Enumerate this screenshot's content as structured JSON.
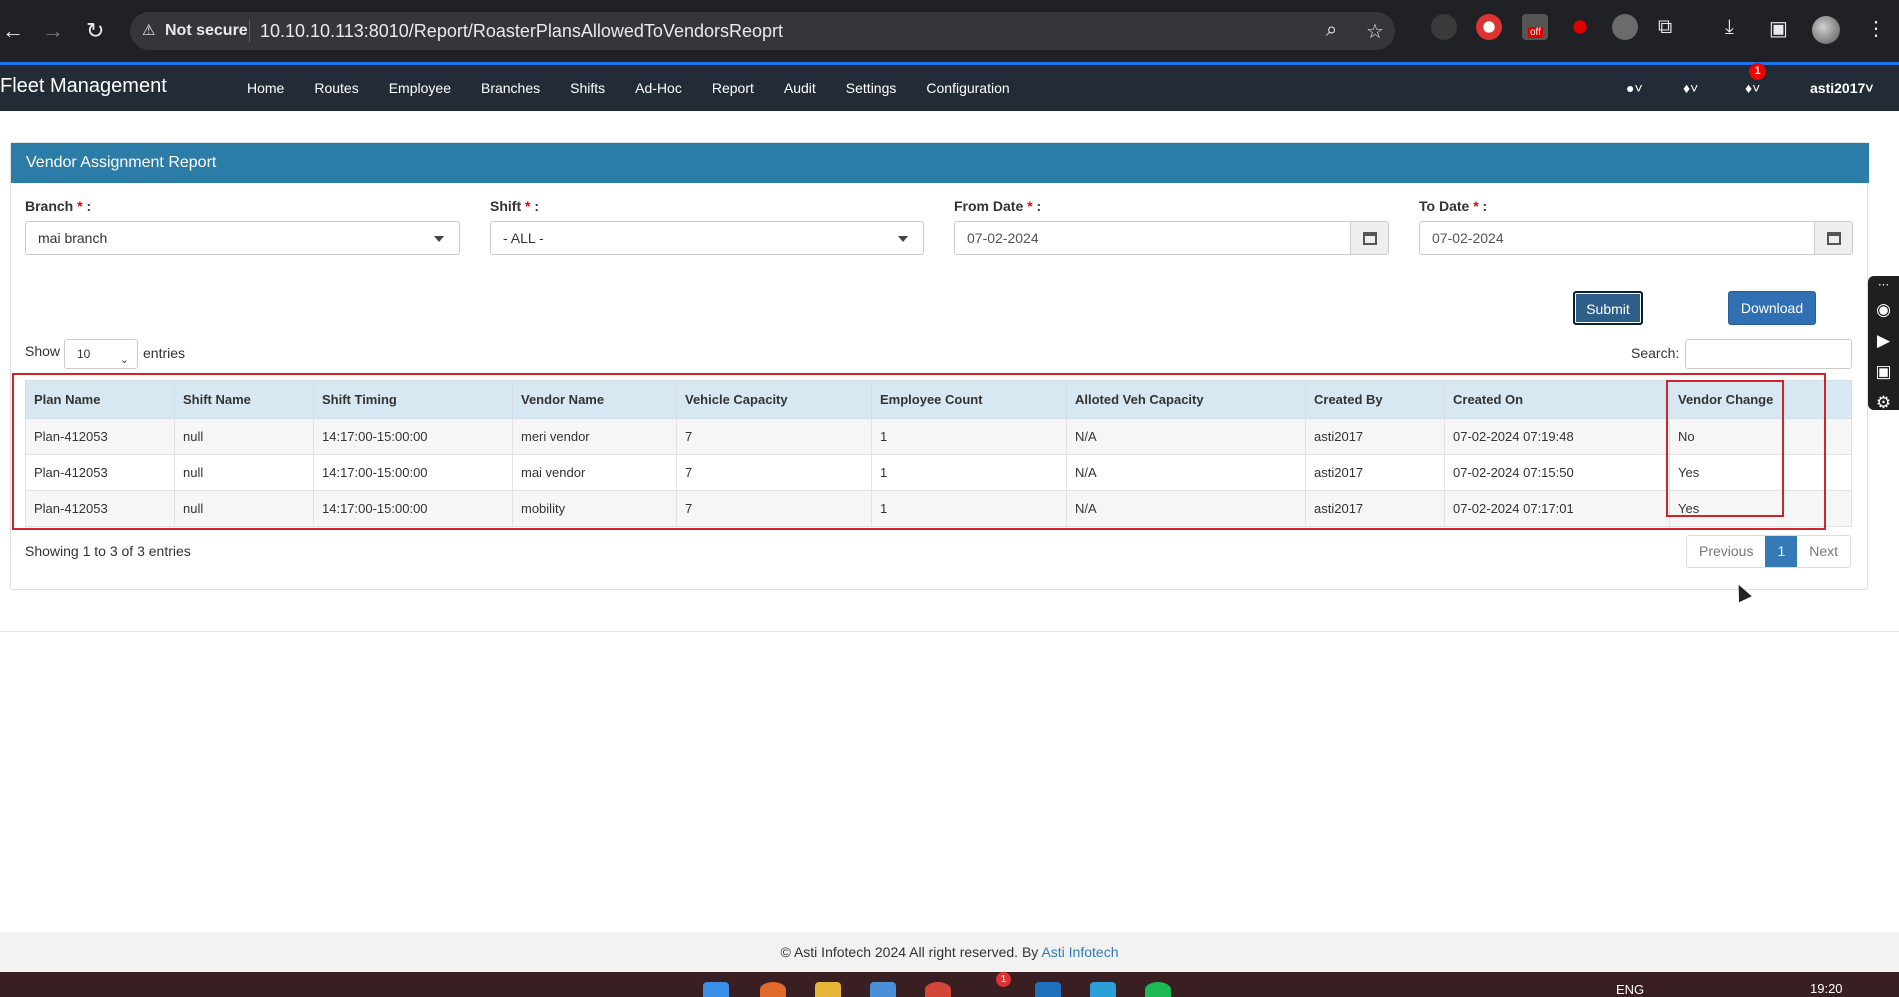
{
  "browser": {
    "not_secure": "Not secure",
    "url": "10.10.10.113:8010/Report/RoasterPlansAllowedToVendorsReoprt",
    "ext_badge": "off"
  },
  "navbar": {
    "brand": "Fleet Management",
    "menu": [
      "Home",
      "Routes",
      "Employee",
      "Branches",
      "Shifts",
      "Ad-Hoc",
      "Report",
      "Audit",
      "Settings",
      "Configuration"
    ],
    "notification_count": "1",
    "user": "asti2017"
  },
  "panel": {
    "title": "Vendor Assignment Report"
  },
  "filters": {
    "branch_label": "Branch",
    "branch_value": "mai branch",
    "shift_label": "Shift",
    "shift_value": "- ALL -",
    "from_label": "From Date",
    "from_value": "07-02-2024",
    "to_label": "To Date",
    "to_value": "07-02-2024",
    "required_mark": "*",
    "colon": ":"
  },
  "actions": {
    "submit": "Submit",
    "download": "Download"
  },
  "table_controls": {
    "show": "Show",
    "page_length": "10",
    "entries": "entries",
    "search": "Search:"
  },
  "table": {
    "columns": [
      "Plan Name",
      "Shift Name",
      "Shift Timing",
      "Vendor Name",
      "Vehicle Capacity",
      "Employee Count",
      "Alloted Veh Capacity",
      "Created By",
      "Created On",
      "Vendor Change"
    ],
    "rows": [
      [
        "Plan-412053",
        "null",
        "14:17:00-15:00:00",
        "meri vendor",
        "7",
        "1",
        "N/A",
        "asti2017",
        "07-02-2024 07:19:48",
        "No"
      ],
      [
        "Plan-412053",
        "null",
        "14:17:00-15:00:00",
        "mai vendor",
        "7",
        "1",
        "N/A",
        "asti2017",
        "07-02-2024 07:15:50",
        "Yes"
      ],
      [
        "Plan-412053",
        "null",
        "14:17:00-15:00:00",
        "mobility",
        "7",
        "1",
        "N/A",
        "asti2017",
        "07-02-2024 07:17:01",
        "Yes"
      ]
    ]
  },
  "pagination": {
    "info": "Showing 1 to 3 of 3 entries",
    "previous": "Previous",
    "current": "1",
    "next": "Next"
  },
  "footer": {
    "text": "© Asti Infotech 2024 All right reserved. By",
    "link": "Asti Infotech"
  },
  "taskbar": {
    "lang": "ENG",
    "time": "19:20",
    "badge": "1"
  }
}
